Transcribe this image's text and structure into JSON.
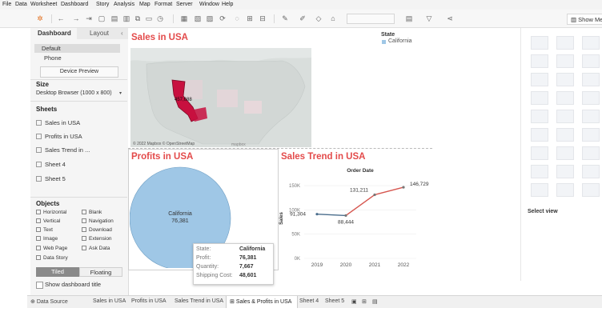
{
  "menu": [
    "File",
    "Data",
    "Worksheet",
    "Dashboard",
    "Story",
    "Analysis",
    "Map",
    "Format",
    "Server",
    "Window",
    "Help"
  ],
  "toolbar": {
    "show_me_label": "Show Me"
  },
  "left_pane": {
    "tabs": [
      "Dashboard",
      "Layout"
    ],
    "devices": [
      "Default",
      "Phone"
    ],
    "device_preview_label": "Device Preview",
    "size_title": "Size",
    "size_value": "Desktop Browser (1000 x 800)",
    "sheets_title": "Sheets",
    "sheets": [
      "Sales in USA",
      "Profits in USA",
      "Sales Trend in ...",
      "Sheet 4",
      "Sheet 5"
    ],
    "objects_title": "Objects",
    "objects": [
      "Horizontal",
      "Blank",
      "Vertical",
      "Navigation",
      "Text",
      "Download",
      "Image",
      "Extension",
      "Web Page",
      "Ask Data",
      "Data Story"
    ],
    "tiled_label": "Tiled",
    "floating_label": "Floating",
    "show_title_label": "Show dashboard title"
  },
  "dashboard": {
    "map_title": "Sales in USA",
    "map_value_label": "457,688",
    "map_credit": "© 2022 Mapbox © OpenStreetMap",
    "map_logo": "mapbox",
    "legend_title": "State",
    "legend_item": "California",
    "pie_title": "Profits in USA",
    "pie_label_state": "California",
    "pie_label_value": "76,381",
    "tooltip": {
      "rows": [
        {
          "key": "State:",
          "value": "California"
        },
        {
          "key": "Profit:",
          "value": "76,381"
        },
        {
          "key": "Quantity:",
          "value": "7,667"
        },
        {
          "key": "Shipping Cost:",
          "value": "48,601"
        }
      ]
    },
    "trend_title": "Sales Trend in USA"
  },
  "chart_data": {
    "type": "line",
    "title": "Order Date",
    "xlabel": "",
    "ylabel": "Sales",
    "x": [
      "2019",
      "2020",
      "2021",
      "2022"
    ],
    "series": [
      {
        "values": [
          91304,
          88444,
          131211,
          146729
        ]
      }
    ],
    "data_labels": [
      "91,304",
      "88,444",
      "131,211",
      "146,729"
    ],
    "yticks": [
      "0K",
      "50K",
      "100K",
      "150K"
    ],
    "ylim": [
      0,
      165000
    ]
  },
  "right_pane": {
    "select_view": "Select view"
  },
  "tabs": [
    "Data Source",
    "Sales in USA",
    "Profits in USA",
    "Sales Trend in USA",
    "Sales & Profits in USA",
    "Sheet 4",
    "Sheet 5"
  ],
  "colors": {
    "accent": "#e34a4a",
    "pie": "#9fc7e6",
    "line_down": "#4a6d8c",
    "line_up": "#d6564f",
    "california": "#c8103f"
  }
}
